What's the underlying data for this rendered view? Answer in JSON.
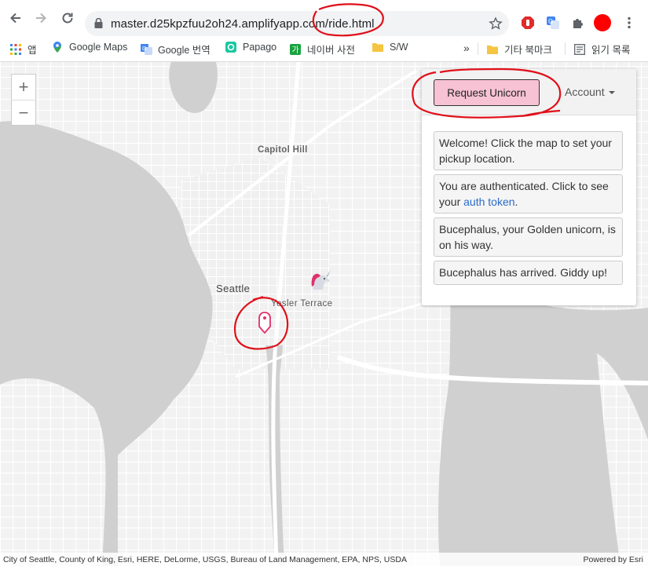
{
  "browser": {
    "url": "master.d25kpzfuu2oh24.amplifyapp.com/ride.html",
    "bookmarks": [
      {
        "label": "앱",
        "icon": "apps-grid-icon"
      },
      {
        "label": "Google Maps",
        "icon": "maps-pin-icon"
      },
      {
        "label": "Google 번역",
        "icon": "translate-icon"
      },
      {
        "label": "Papago",
        "icon": "papago-icon"
      },
      {
        "label": "네이버 사전",
        "icon": "naver-dictionary-icon"
      },
      {
        "label": "S/W",
        "icon": "folder-icon"
      },
      {
        "label": "기타 북마크",
        "icon": "folder-icon"
      },
      {
        "label": "읽기 목록",
        "icon": "reading-list-icon"
      }
    ],
    "overflow": "»"
  },
  "map": {
    "labels": {
      "capitol_hill": "Capitol Hill",
      "seattle": "Seattle",
      "yesler_terrace": "Yesler Terrace"
    },
    "zoom_in": "+",
    "zoom_out": "−",
    "attribution": "City of Seattle, County of King, Esri, HERE, DeLorme, USGS, Bureau of Land Management, EPA, NPS, USDA",
    "powered_by": "Powered by Esri"
  },
  "panel": {
    "request_button": "Request Unicorn",
    "account_label": "Account",
    "messages": {
      "welcome": "Welcome! Click the map to set your pickup location.",
      "auth_prefix": "You are authenticated. Click to see your ",
      "auth_link": "auth token",
      "auth_suffix": ".",
      "on_way": "Bucephalus, your Golden unicorn, is on his way.",
      "arrived": "Bucephalus has arrived. Giddy up!"
    }
  },
  "colors": {
    "request_button_bg": "#f7c2d3",
    "annotation_red": "#e0101a",
    "pin_pink": "#e0316b",
    "link_blue": "#2a6bc8"
  }
}
